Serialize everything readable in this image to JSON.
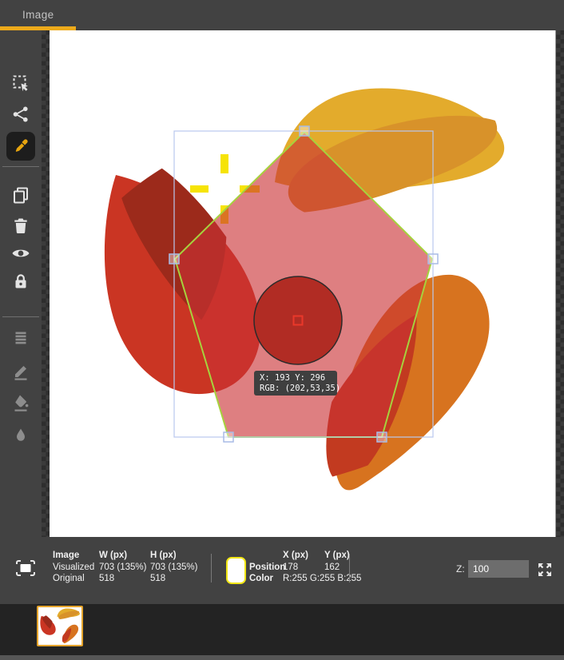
{
  "window": {
    "tab_label": "Image"
  },
  "toolbar": {
    "tools": [
      {
        "name": "rect-select",
        "state": "enabled"
      },
      {
        "name": "polygon-select",
        "state": "enabled"
      },
      {
        "name": "eyedropper",
        "state": "active"
      },
      {
        "name": "copy",
        "state": "enabled"
      },
      {
        "name": "delete",
        "state": "enabled"
      },
      {
        "name": "visibility",
        "state": "enabled"
      },
      {
        "name": "lock",
        "state": "enabled"
      },
      {
        "name": "layers",
        "state": "disabled"
      },
      {
        "name": "draw",
        "state": "disabled"
      },
      {
        "name": "fill",
        "state": "disabled"
      },
      {
        "name": "blur",
        "state": "disabled"
      }
    ]
  },
  "canvas": {
    "tooltip": {
      "line1": "X: 193 Y: 296",
      "line2": "RGB: (202,53,35)"
    },
    "colors": {
      "petal_yellow": "#e3ab2c",
      "petal_yellow_shade": "#d8922a",
      "petal_red": "#ca3523",
      "petal_red_shade": "#9c2a1b",
      "petal_orange": "#d7731f",
      "petal_orange_shade": "#c23a20",
      "selection_fill": "#ca3034",
      "selection_stroke": "#a6d23d",
      "bbox_stroke": "#b9c7ee",
      "crosshair": "#f6e306",
      "circle_fill": "#b12c24",
      "sample_marker": "#ea382a"
    }
  },
  "statusbar": {
    "image_table": {
      "headers": [
        "Image",
        "W (px)",
        "H (px)"
      ],
      "rows": [
        [
          "Visualized",
          "703 (135%)",
          "703 (135%)"
        ],
        [
          "Original",
          "518",
          "518"
        ]
      ]
    },
    "pointer_table": {
      "x_header": "X (px)",
      "y_header": "Y (px)",
      "position_label": "Position",
      "position_x": "178",
      "position_y": "162",
      "color_label": "Color",
      "color_value": "R:255 G:255 B:255",
      "swatch_color": "#ffffff"
    },
    "zoom": {
      "label": "Z:",
      "value": "100"
    }
  }
}
